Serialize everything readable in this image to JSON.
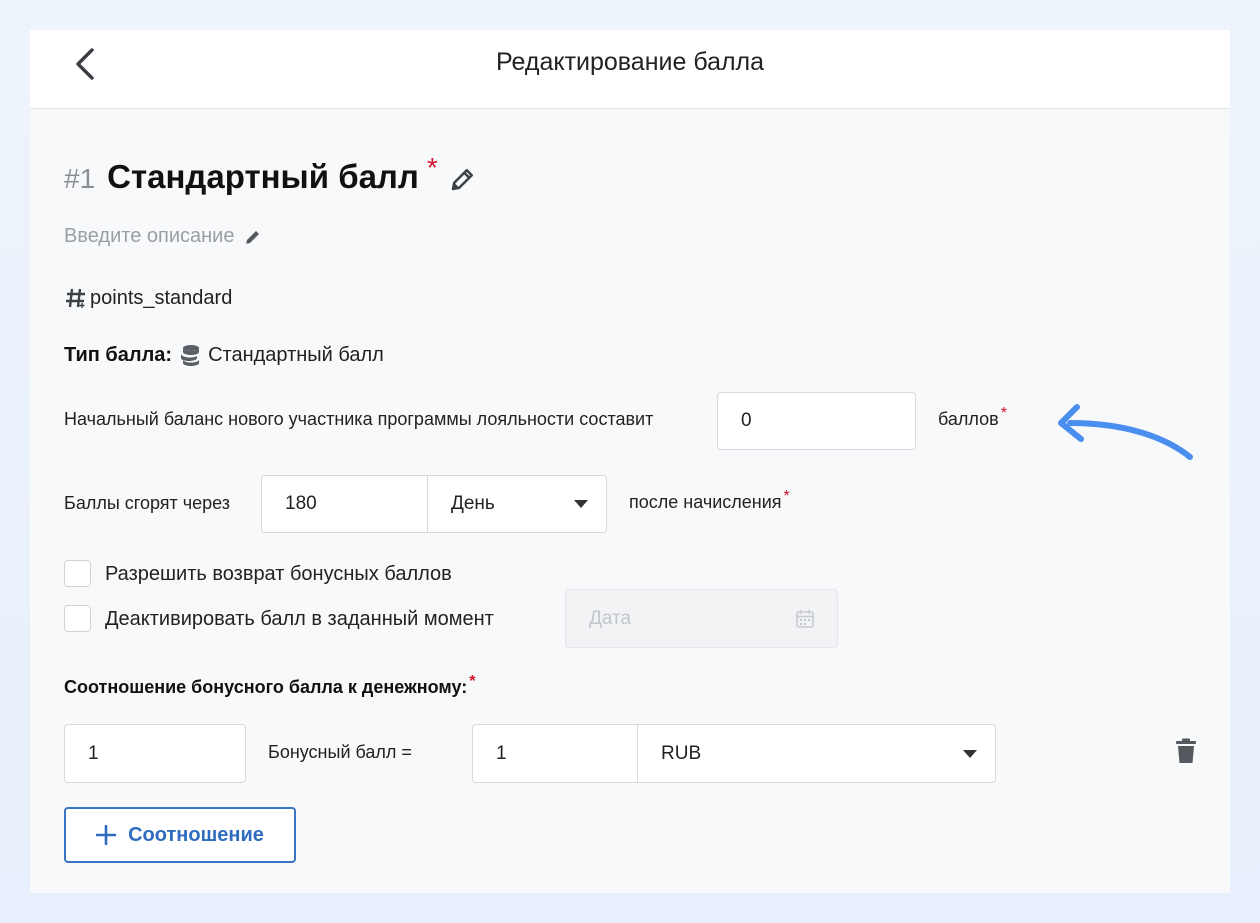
{
  "header": {
    "title": "Редактирование балла"
  },
  "point": {
    "number": "#1",
    "name": "Стандартный балл",
    "required_mark": "*",
    "description_placeholder": "Введите описание",
    "code": "points_standard",
    "type_label": "Тип балла:",
    "type_value": "Стандартный балл"
  },
  "initial_balance": {
    "label": "Начальный баланс нового участника программы лояльности составит",
    "value": "0",
    "unit": "баллов",
    "required_mark": "*"
  },
  "expiry": {
    "label": "Баллы сгорят через",
    "value": "180",
    "period": "День",
    "suffix": "после начисления",
    "required_mark": "*"
  },
  "options": {
    "allow_return_label": "Разрешить возврат бонусных баллов",
    "allow_return_checked": false,
    "deactivate_label": "Деактивировать балл в заданный момент",
    "deactivate_checked": false,
    "date_placeholder": "Дата"
  },
  "ratio": {
    "title": "Соотношение бонусного балла к денежному:",
    "required_mark": "*",
    "bonus_value": "1",
    "equals_label": "Бонусный балл =",
    "money_value": "1",
    "currency": "RUB",
    "add_button_label": "Соотношение"
  },
  "colors": {
    "accent": "#3a74c5",
    "required": "#d0142c",
    "annotation_arrow": "#4a8ef0"
  },
  "icons": {
    "back": "chevron-left-icon",
    "edit": "pencil-icon",
    "code": "hashtag-icon",
    "type": "coins-icon",
    "calendar": "calendar-icon",
    "delete": "trash-icon",
    "add": "plus-icon",
    "annotation": "curved-arrow-icon"
  }
}
